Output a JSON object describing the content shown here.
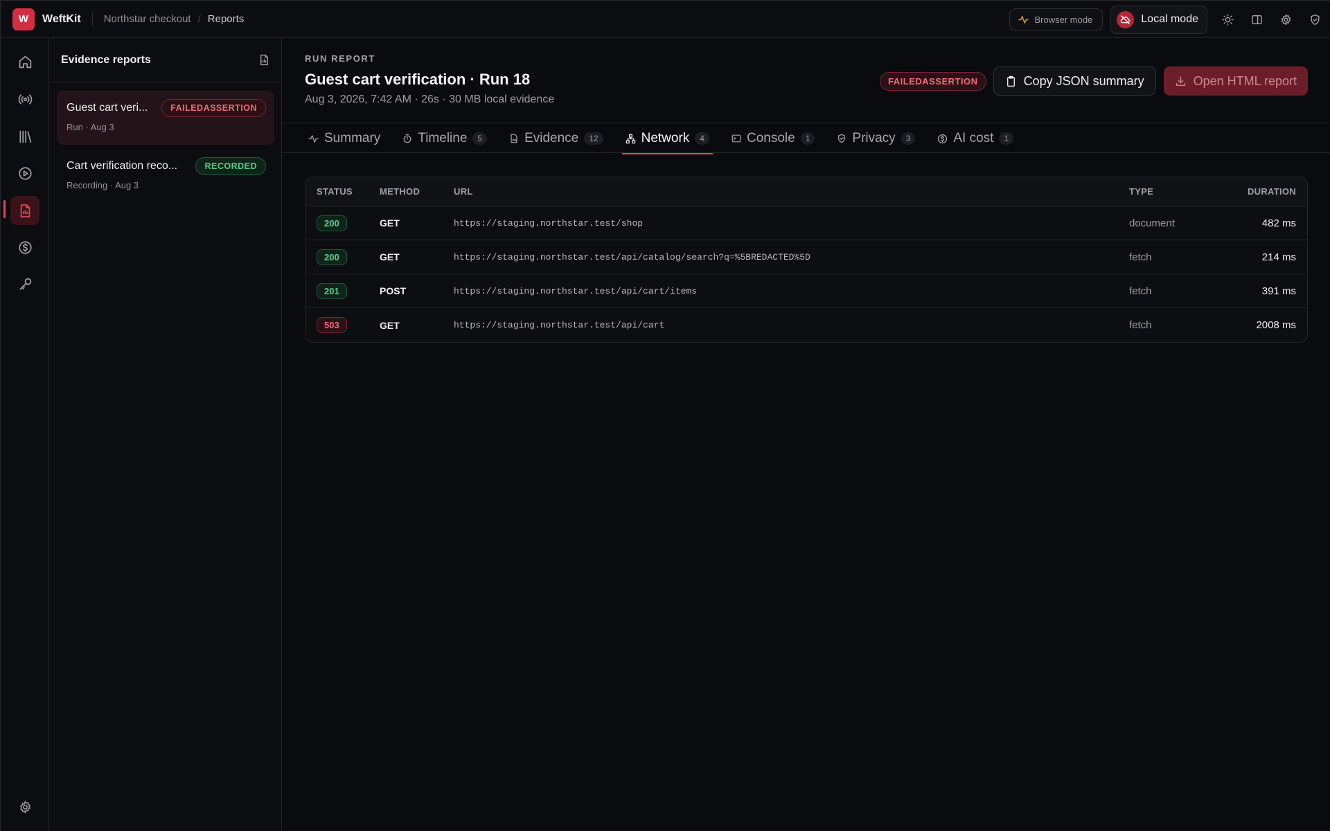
{
  "app": {
    "logo_letter": "W",
    "name": "WeftKit"
  },
  "breadcrumb": [
    "Northstar checkout",
    "Reports"
  ],
  "top": {
    "browser_mode": "Browser mode",
    "local_mode": "Local mode"
  },
  "reports_panel": {
    "title": "Evidence reports",
    "items": [
      {
        "title": "Guest cart veri...",
        "badge": "FAILEDASSERTION",
        "sub": "Run · Aug 3"
      },
      {
        "title": "Cart verification reco...",
        "badge": "RECORDED",
        "sub": "Recording · Aug 3"
      }
    ]
  },
  "report": {
    "eyebrow": "RUN REPORT",
    "title": "Guest cart verification · Run 18",
    "meta": "Aug 3, 2026, 7:42 AM · 26s · 30 MB local evidence",
    "status_badge": "FAILEDASSERTION",
    "copy_label": "Copy JSON summary",
    "open_label": "Open HTML report"
  },
  "tabs": [
    {
      "label": "Summary",
      "count": ""
    },
    {
      "label": "Timeline",
      "count": "5"
    },
    {
      "label": "Evidence",
      "count": "12"
    },
    {
      "label": "Network",
      "count": "4"
    },
    {
      "label": "Console",
      "count": "1"
    },
    {
      "label": "Privacy",
      "count": "3"
    },
    {
      "label": "AI cost",
      "count": "1"
    }
  ],
  "network": {
    "columns": [
      "STATUS",
      "METHOD",
      "URL",
      "TYPE",
      "DURATION"
    ],
    "rows": [
      {
        "status": "200",
        "method": "GET",
        "url": "https://staging.northstar.test/shop",
        "type": "document",
        "duration": "482 ms"
      },
      {
        "status": "200",
        "method": "GET",
        "url": "https://staging.northstar.test/api/catalog/search?q=%5BREDACTED%5D",
        "type": "fetch",
        "duration": "214 ms"
      },
      {
        "status": "201",
        "method": "POST",
        "url": "https://staging.northstar.test/api/cart/items",
        "type": "fetch",
        "duration": "391 ms"
      },
      {
        "status": "503",
        "method": "GET",
        "url": "https://staging.northstar.test/api/cart",
        "type": "fetch",
        "duration": "2008 ms"
      }
    ]
  },
  "colors": {
    "accent": "#e0485c",
    "success": "#55d494",
    "danger": "#f06a7c"
  }
}
